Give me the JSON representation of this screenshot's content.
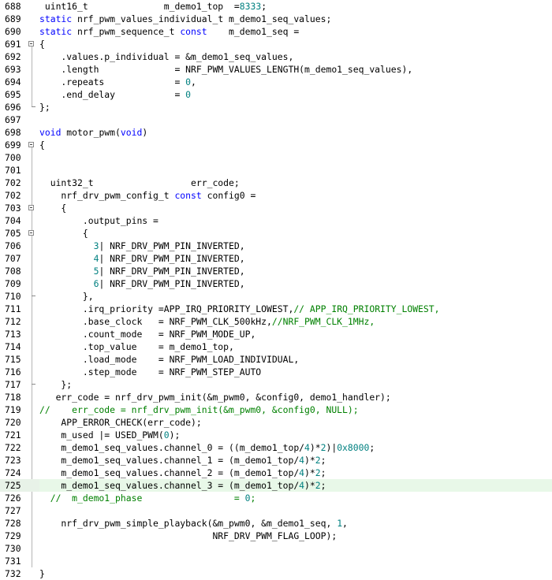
{
  "colors": {
    "keyword": "#0000ff",
    "number": "#008080",
    "comment": "#008000",
    "text": "#000000",
    "current_line": "#e8f8e8"
  },
  "lines": [
    {
      "n": "688",
      "fold": "",
      "t": [
        [
          "pl",
          " uint16_t              m_demo1_top  ="
        ],
        [
          "num",
          "8333"
        ],
        [
          "pl",
          ";"
        ]
      ]
    },
    {
      "n": "689",
      "fold": "",
      "t": [
        [
          "kw",
          "static"
        ],
        [
          "pl",
          " nrf_pwm_values_individual_t m_demo1_seq_values;"
        ]
      ]
    },
    {
      "n": "690",
      "fold": "",
      "t": [
        [
          "kw",
          "static"
        ],
        [
          "pl",
          " nrf_pwm_sequence_t "
        ],
        [
          "kw",
          "const"
        ],
        [
          "pl",
          "    m_demo1_seq ="
        ]
      ]
    },
    {
      "n": "691",
      "fold": "open",
      "t": [
        [
          "pl",
          "{"
        ]
      ]
    },
    {
      "n": "692",
      "fold": "",
      "t": [
        [
          "pl",
          "    .values.p_individual = &m_demo1_seq_values,"
        ]
      ]
    },
    {
      "n": "693",
      "fold": "",
      "t": [
        [
          "pl",
          "    .length              = NRF_PWM_VALUES_LENGTH(m_demo1_seq_values),"
        ]
      ]
    },
    {
      "n": "694",
      "fold": "",
      "t": [
        [
          "pl",
          "    .repeats             = "
        ],
        [
          "num",
          "0"
        ],
        [
          "pl",
          ","
        ]
      ]
    },
    {
      "n": "695",
      "fold": "",
      "t": [
        [
          "pl",
          "    .end_delay           = "
        ],
        [
          "num",
          "0"
        ]
      ]
    },
    {
      "n": "696",
      "fold": "end",
      "t": [
        [
          "pl",
          "};"
        ]
      ]
    },
    {
      "n": "697",
      "fold": "",
      "t": [
        [
          "pl",
          ""
        ]
      ]
    },
    {
      "n": "698",
      "fold": "",
      "t": [
        [
          "kw",
          "void"
        ],
        [
          "pl",
          " motor_pwm("
        ],
        [
          "kw",
          "void"
        ],
        [
          "pl",
          ")"
        ]
      ]
    },
    {
      "n": "699",
      "fold": "open",
      "t": [
        [
          "pl",
          "{"
        ]
      ]
    },
    {
      "n": "700",
      "fold": "",
      "t": [
        [
          "pl",
          ""
        ]
      ]
    },
    {
      "n": "701",
      "fold": "",
      "t": [
        [
          "pl",
          ""
        ]
      ]
    },
    {
      "n": "702",
      "fold": "",
      "t": [
        [
          "pl",
          "  uint32_t                  err_code;"
        ]
      ]
    },
    {
      "n": "702",
      "fold": "",
      "t": [
        [
          "pl",
          "    nrf_drv_pwm_config_t "
        ],
        [
          "kw",
          "const"
        ],
        [
          "pl",
          " config0 ="
        ]
      ]
    },
    {
      "n": "703",
      "fold": "open",
      "t": [
        [
          "pl",
          "    {"
        ]
      ]
    },
    {
      "n": "704",
      "fold": "",
      "t": [
        [
          "pl",
          "        .output_pins ="
        ]
      ]
    },
    {
      "n": "705",
      "fold": "open",
      "t": [
        [
          "pl",
          "        {"
        ]
      ]
    },
    {
      "n": "706",
      "fold": "",
      "t": [
        [
          "pl",
          "          "
        ],
        [
          "num",
          "3"
        ],
        [
          "pl",
          "| NRF_DRV_PWM_PIN_INVERTED,"
        ]
      ]
    },
    {
      "n": "707",
      "fold": "",
      "t": [
        [
          "pl",
          "          "
        ],
        [
          "num",
          "4"
        ],
        [
          "pl",
          "| NRF_DRV_PWM_PIN_INVERTED,"
        ]
      ]
    },
    {
      "n": "708",
      "fold": "",
      "t": [
        [
          "pl",
          "          "
        ],
        [
          "num",
          "5"
        ],
        [
          "pl",
          "| NRF_DRV_PWM_PIN_INVERTED,"
        ]
      ]
    },
    {
      "n": "709",
      "fold": "",
      "t": [
        [
          "pl",
          "          "
        ],
        [
          "num",
          "6"
        ],
        [
          "pl",
          "| NRF_DRV_PWM_PIN_INVERTED,"
        ]
      ]
    },
    {
      "n": "710",
      "fold": "end",
      "t": [
        [
          "pl",
          "        },"
        ]
      ]
    },
    {
      "n": "711",
      "fold": "",
      "t": [
        [
          "pl",
          "        .irq_priority =APP_IRQ_PRIORITY_LOWEST,"
        ],
        [
          "cm",
          "// APP_IRQ_PRIORITY_LOWEST,"
        ]
      ]
    },
    {
      "n": "712",
      "fold": "",
      "t": [
        [
          "pl",
          "        .base_clock   = NRF_PWM_CLK_500kHz,"
        ],
        [
          "cm",
          "//NRF_PWM_CLK_1MHz,"
        ]
      ]
    },
    {
      "n": "713",
      "fold": "",
      "t": [
        [
          "pl",
          "        .count_mode   = NRF_PWM_MODE_UP,"
        ]
      ]
    },
    {
      "n": "714",
      "fold": "",
      "t": [
        [
          "pl",
          "        .top_value    = m_demo1_top,"
        ]
      ]
    },
    {
      "n": "715",
      "fold": "",
      "t": [
        [
          "pl",
          "        .load_mode    = NRF_PWM_LOAD_INDIVIDUAL,"
        ]
      ]
    },
    {
      "n": "716",
      "fold": "",
      "t": [
        [
          "pl",
          "        .step_mode    = NRF_PWM_STEP_AUTO"
        ]
      ]
    },
    {
      "n": "717",
      "fold": "end",
      "t": [
        [
          "pl",
          "    };"
        ]
      ]
    },
    {
      "n": "718",
      "fold": "",
      "t": [
        [
          "pl",
          "   err_code = nrf_drv_pwm_init(&m_pwm0, &config0, demo1_handler);"
        ]
      ]
    },
    {
      "n": "719",
      "fold": "",
      "t": [
        [
          "cm",
          "//    err_code = nrf_drv_pwm_init(&m_pwm0, &config0, NULL);"
        ]
      ]
    },
    {
      "n": "720",
      "fold": "",
      "t": [
        [
          "pl",
          "    APP_ERROR_CHECK(err_code);"
        ]
      ]
    },
    {
      "n": "721",
      "fold": "",
      "t": [
        [
          "pl",
          "    m_used |= USED_PWM("
        ],
        [
          "num",
          "0"
        ],
        [
          "pl",
          ");"
        ]
      ]
    },
    {
      "n": "722",
      "fold": "",
      "t": [
        [
          "pl",
          "    m_demo1_seq_values.channel_0 = ((m_demo1_top/"
        ],
        [
          "num",
          "4"
        ],
        [
          "pl",
          ")*"
        ],
        [
          "num",
          "2"
        ],
        [
          "pl",
          ")|"
        ],
        [
          "num",
          "0x8000"
        ],
        [
          "pl",
          ";"
        ]
      ]
    },
    {
      "n": "723",
      "fold": "",
      "t": [
        [
          "pl",
          "    m_demo1_seq_values.channel_1 = (m_demo1_top/"
        ],
        [
          "num",
          "4"
        ],
        [
          "pl",
          ")*"
        ],
        [
          "num",
          "2"
        ],
        [
          "pl",
          ";"
        ]
      ]
    },
    {
      "n": "724",
      "fold": "",
      "t": [
        [
          "pl",
          "    m_demo1_seq_values.channel_2 = (m_demo1_top/"
        ],
        [
          "num",
          "4"
        ],
        [
          "pl",
          ")*"
        ],
        [
          "num",
          "2"
        ],
        [
          "pl",
          ";"
        ]
      ]
    },
    {
      "n": "725",
      "fold": "",
      "hl": true,
      "t": [
        [
          "pl",
          "    m_demo1_seq_values.channel_3 = (m_demo1_top/"
        ],
        [
          "num",
          "4"
        ],
        [
          "pl",
          ")*"
        ],
        [
          "num",
          "2"
        ],
        [
          "pl",
          ";"
        ]
      ]
    },
    {
      "n": "726",
      "fold": "",
      "t": [
        [
          "cm",
          "  //  m_demo1_phase                 = "
        ],
        [
          "num",
          "0"
        ],
        [
          "cm",
          ";"
        ]
      ]
    },
    {
      "n": "727",
      "fold": "",
      "t": [
        [
          "pl",
          ""
        ]
      ]
    },
    {
      "n": "728",
      "fold": "",
      "t": [
        [
          "pl",
          "    nrf_drv_pwm_simple_playback(&m_pwm0, &m_demo1_seq, "
        ],
        [
          "num",
          "1"
        ],
        [
          "pl",
          ","
        ]
      ]
    },
    {
      "n": "729",
      "fold": "",
      "t": [
        [
          "pl",
          "                                NRF_DRV_PWM_FLAG_LOOP);"
        ]
      ]
    },
    {
      "n": "730",
      "fold": "",
      "t": [
        [
          "pl",
          ""
        ]
      ]
    },
    {
      "n": "731",
      "fold": "",
      "t": [
        [
          "pl",
          ""
        ]
      ]
    },
    {
      "n": "732",
      "fold": "",
      "t": [
        [
          "pl",
          "}"
        ]
      ]
    }
  ]
}
